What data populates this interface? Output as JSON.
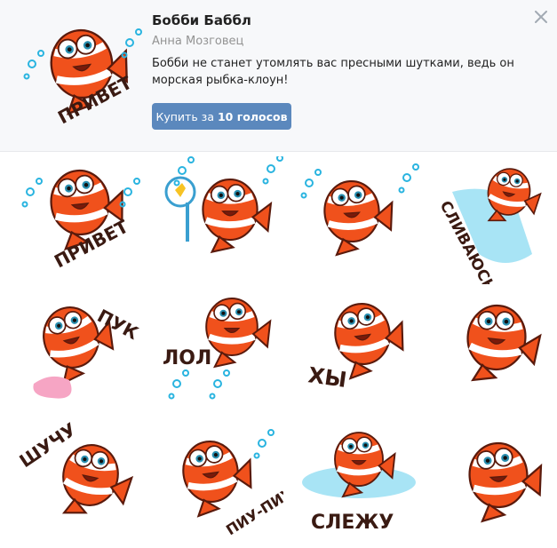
{
  "pack": {
    "title": "Бобби Баббл",
    "author": "Анна Мозговец",
    "description": "Бобби не станет утомлять вас пресными шутками, ведь он морская рыбка-клоун!",
    "buy_prefix": "Купить за",
    "buy_amount": "10 голосов"
  },
  "icons": {
    "close": "close-icon"
  },
  "colors": {
    "button": "#5b88bd",
    "fish": "#f0511c",
    "header_bg": "#f7f8fa"
  },
  "stickers": [
    {
      "caption": "ПРИВЕТ"
    },
    {
      "caption": ""
    },
    {
      "caption": ""
    },
    {
      "caption": "СЛИВАЮСЬ"
    },
    {
      "caption": "ПУК"
    },
    {
      "caption": "ЛОЛ"
    },
    {
      "caption": "ХЫ"
    },
    {
      "caption": ""
    },
    {
      "caption": "ШУЧУ"
    },
    {
      "caption": "ПИУ-ПИУ"
    },
    {
      "caption": "СЛЕЖУ"
    },
    {
      "caption": ""
    }
  ]
}
